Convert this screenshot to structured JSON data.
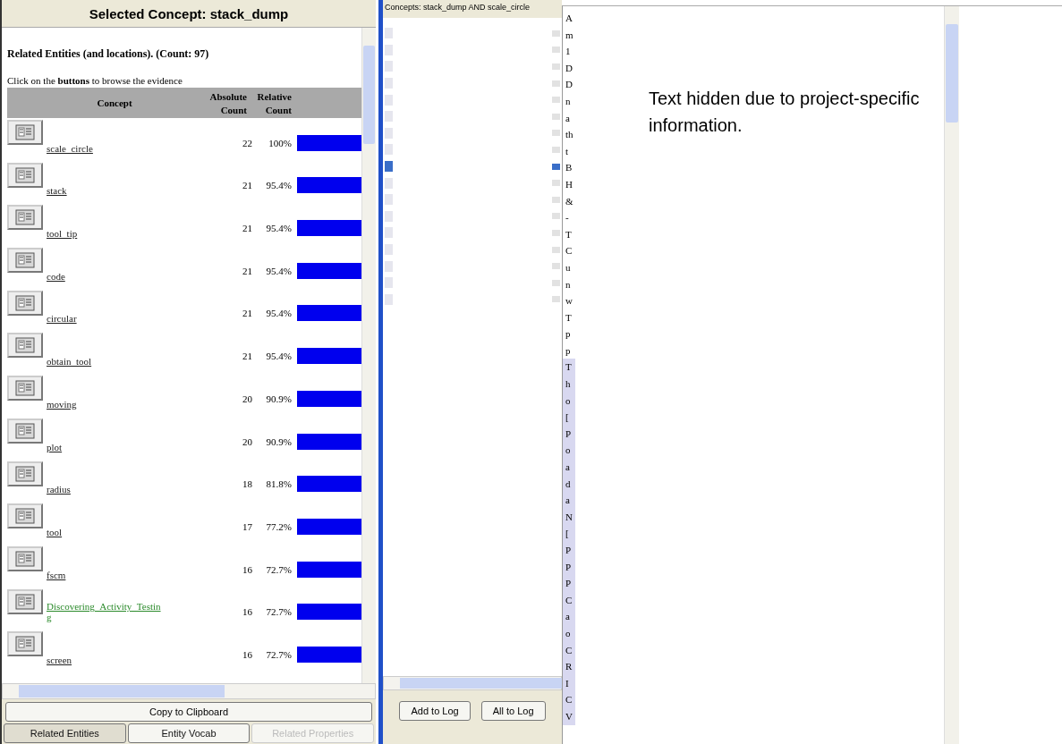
{
  "left_panel": {
    "title": "Selected Concept: stack_dump",
    "heading": "Related Entities (and locations). (Count: 97)",
    "instruction": "Click on the **buttons** to browse the evidence",
    "table": {
      "columns": [
        "Concept",
        "Absolute Count",
        "Relative Count"
      ],
      "rows": [
        {
          "concept": "scale_circle",
          "count": "22",
          "percent": "100%",
          "visited": false
        },
        {
          "concept": "stack",
          "count": "21",
          "percent": "95.4%",
          "visited": false
        },
        {
          "concept": "tool_tip",
          "count": "21",
          "percent": "95.4%",
          "visited": false
        },
        {
          "concept": "code",
          "count": "21",
          "percent": "95.4%",
          "visited": false
        },
        {
          "concept": "circular",
          "count": "21",
          "percent": "95.4%",
          "visited": false
        },
        {
          "concept": "obtain_tool",
          "count": "21",
          "percent": "95.4%",
          "visited": false
        },
        {
          "concept": "moving",
          "count": "20",
          "percent": "90.9%",
          "visited": false
        },
        {
          "concept": "plot",
          "count": "20",
          "percent": "90.9%",
          "visited": false
        },
        {
          "concept": "radius",
          "count": "18",
          "percent": "81.8%",
          "visited": false
        },
        {
          "concept": "tool",
          "count": "17",
          "percent": "77.2%",
          "visited": false
        },
        {
          "concept": "fscm",
          "count": "16",
          "percent": "72.7%",
          "visited": false
        },
        {
          "concept": "Discovering_Activity_Testing",
          "count": "16",
          "percent": "72.7%",
          "visited": true
        },
        {
          "concept": "screen",
          "count": "16",
          "percent": "72.7%",
          "visited": false
        }
      ]
    },
    "copy_button": "Copy to Clipboard",
    "tabs": [
      {
        "label": "Related Entities",
        "selected": true,
        "disabled": false
      },
      {
        "label": "Entity Vocab",
        "selected": false,
        "disabled": false
      },
      {
        "label": "Related Properties",
        "selected": false,
        "disabled": true
      }
    ]
  },
  "middle_panel": {
    "title": "Concepts:  stack_dump AND scale_circle",
    "results": [
      {
        "selected": false
      },
      {
        "selected": false
      },
      {
        "selected": false
      },
      {
        "selected": false
      },
      {
        "selected": false
      },
      {
        "selected": false
      },
      {
        "selected": false
      },
      {
        "selected": false
      },
      {
        "selected": true
      },
      {
        "selected": false
      },
      {
        "selected": false
      },
      {
        "selected": false
      },
      {
        "selected": false
      },
      {
        "selected": false
      },
      {
        "selected": false
      },
      {
        "selected": false
      },
      {
        "selected": false
      }
    ],
    "buttons": [
      "Add to Log",
      "All to Log"
    ]
  },
  "right_panel": {
    "line_fragments": [
      {
        "text": "A",
        "highlighted": false
      },
      {
        "text": "m",
        "highlighted": false
      },
      {
        "text": "1",
        "highlighted": false
      },
      {
        "text": "D",
        "highlighted": false
      },
      {
        "text": "D",
        "highlighted": false
      },
      {
        "text": "n",
        "highlighted": false
      },
      {
        "text": "a",
        "highlighted": false
      },
      {
        "text": "th",
        "highlighted": false
      },
      {
        "text": "t",
        "highlighted": false
      },
      {
        "text": "B",
        "highlighted": false
      },
      {
        "text": "H",
        "highlighted": false
      },
      {
        "text": "&",
        "highlighted": false
      },
      {
        "text": "-",
        "highlighted": false
      },
      {
        "text": "T",
        "highlighted": false
      },
      {
        "text": "C",
        "highlighted": false
      },
      {
        "text": "u",
        "highlighted": false
      },
      {
        "text": "n",
        "highlighted": false
      },
      {
        "text": "w",
        "highlighted": false
      },
      {
        "text": "T",
        "highlighted": false
      },
      {
        "text": "p",
        "highlighted": false
      },
      {
        "text": "p",
        "highlighted": false
      },
      {
        "text": "T",
        "highlighted": true
      },
      {
        "text": "h",
        "highlighted": true
      },
      {
        "text": "o",
        "highlighted": true
      },
      {
        "text": "[",
        "highlighted": true
      },
      {
        "text": "P",
        "highlighted": true
      },
      {
        "text": "o",
        "highlighted": true
      },
      {
        "text": "a",
        "highlighted": true
      },
      {
        "text": "d",
        "highlighted": true
      },
      {
        "text": "a",
        "highlighted": true
      },
      {
        "text": "N",
        "highlighted": true
      },
      {
        "text": "[",
        "highlighted": true
      },
      {
        "text": "P",
        "highlighted": true
      },
      {
        "text": "P",
        "highlighted": true
      },
      {
        "text": "P",
        "highlighted": true
      },
      {
        "text": "C",
        "highlighted": true
      },
      {
        "text": "a",
        "highlighted": true
      },
      {
        "text": "o",
        "highlighted": true
      },
      {
        "text": "C",
        "highlighted": true
      },
      {
        "text": "R",
        "highlighted": true
      },
      {
        "text": "I",
        "highlighted": true
      },
      {
        "text": "C",
        "highlighted": true
      },
      {
        "text": "V",
        "highlighted": true
      }
    ],
    "notice": "Text hidden due to project-specific information."
  }
}
